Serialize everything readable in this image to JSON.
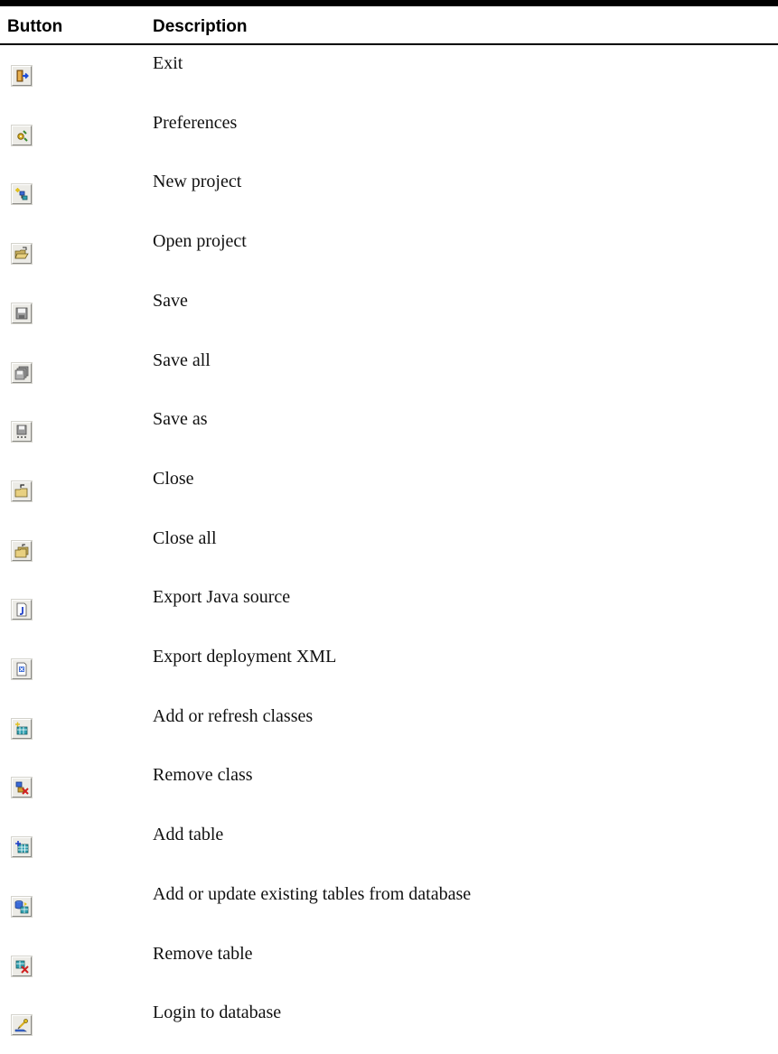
{
  "header": {
    "col_button": "Button",
    "col_description": "Description"
  },
  "rows": [
    {
      "icon": "exit-icon",
      "label": "Exit"
    },
    {
      "icon": "preferences-icon",
      "label": "Preferences"
    },
    {
      "icon": "new-project-icon",
      "label": "New project"
    },
    {
      "icon": "open-project-icon",
      "label": "Open project"
    },
    {
      "icon": "save-icon",
      "label": "Save"
    },
    {
      "icon": "save-all-icon",
      "label": "Save all"
    },
    {
      "icon": "save-as-icon",
      "label": "Save as"
    },
    {
      "icon": "close-icon",
      "label": "Close"
    },
    {
      "icon": "close-all-icon",
      "label": "Close all"
    },
    {
      "icon": "export-java-source-icon",
      "label": "Export Java source"
    },
    {
      "icon": "export-deployment-xml-icon",
      "label": "Export deployment XML"
    },
    {
      "icon": "add-refresh-classes-icon",
      "label": "Add or refresh classes"
    },
    {
      "icon": "remove-class-icon",
      "label": "Remove class"
    },
    {
      "icon": "add-table-icon",
      "label": "Add table"
    },
    {
      "icon": "update-tables-from-database-icon",
      "label": "Add or update existing tables from database"
    },
    {
      "icon": "remove-table-icon",
      "label": "Remove table"
    },
    {
      "icon": "login-database-icon",
      "label": "Login to database"
    }
  ],
  "colors": {
    "icon_face": "#ecebe6",
    "rule": "#000000"
  }
}
